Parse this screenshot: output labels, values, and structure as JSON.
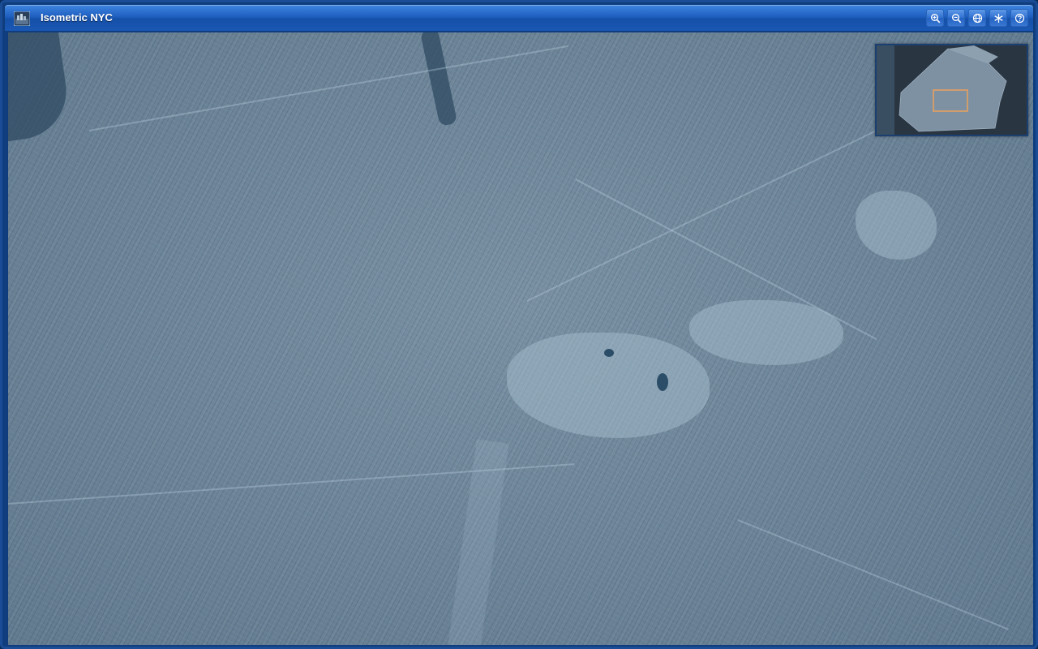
{
  "window": {
    "title": "Isometric NYC",
    "accent_color": "#1f5fc0"
  },
  "toolbar": {
    "buttons": [
      {
        "name": "zoom-in",
        "icon": "zoom-in-icon"
      },
      {
        "name": "zoom-out",
        "icon": "zoom-out-icon"
      },
      {
        "name": "globe",
        "icon": "globe-icon"
      },
      {
        "name": "snowflake",
        "icon": "snowflake-icon"
      },
      {
        "name": "help",
        "icon": "help-icon"
      }
    ]
  },
  "map": {
    "description_color": "#6c8498"
  },
  "minimap": {
    "viewport_color": "#e8a060"
  }
}
